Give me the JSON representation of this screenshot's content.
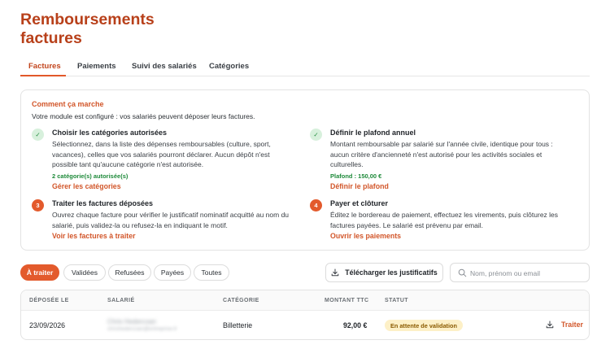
{
  "page": {
    "title_line1": "Remboursements",
    "title_line2": "factures"
  },
  "tabs": [
    {
      "label": "Factures",
      "active": true
    },
    {
      "label": "Paiements",
      "active": false
    },
    {
      "label": "Suivi des salariés",
      "active": false
    },
    {
      "label": "Catégories",
      "active": false
    }
  ],
  "how": {
    "title": "Comment ça marche",
    "subtitle": "Votre module est configuré : vos salariés peuvent déposer leurs factures.",
    "steps": [
      {
        "state": "done",
        "badge": "✓",
        "title": "Choisir les catégories autorisées",
        "description": "Sélectionnez, dans la liste des dépenses remboursables (culture, sport, vacances), celles que vos salariés pourront déclarer. Aucun dépôt n'est possible tant qu'aucune catégorie n'est autorisée.",
        "status": "2 catégorie(s) autorisée(s)",
        "link": "Gérer les catégories"
      },
      {
        "state": "done",
        "badge": "✓",
        "title": "Définir le plafond annuel",
        "description": "Montant remboursable par salarié sur l'année civile, identique pour tous : aucun critère d'ancienneté n'est autorisé pour les activités sociales et culturelles.",
        "status": "Plafond : 150,00 €",
        "link": "Définir le plafond"
      },
      {
        "state": "todo",
        "badge": "3",
        "title": "Traiter les factures déposées",
        "description": "Ouvrez chaque facture pour vérifier le justificatif nominatif acquitté au nom du salarié, puis validez-la ou refusez-la en indiquant le motif.",
        "status": "",
        "link": "Voir les factures à traiter"
      },
      {
        "state": "todo",
        "badge": "4",
        "title": "Payer et clôturer",
        "description": "Éditez le bordereau de paiement, effectuez les virements, puis clôturez les factures payées. Le salarié est prévenu par email.",
        "status": "",
        "link": "Ouvrir les paiements"
      }
    ]
  },
  "filters": [
    {
      "label": "À traiter",
      "active": true
    },
    {
      "label": "Validées",
      "active": false
    },
    {
      "label": "Refusées",
      "active": false
    },
    {
      "label": "Payées",
      "active": false
    },
    {
      "label": "Toutes",
      "active": false
    }
  ],
  "toolbar": {
    "download_label": "Télécharger les justificatifs",
    "search_placeholder": "Nom, prénom ou email",
    "search_value": ""
  },
  "table": {
    "headers": [
      "DÉPOSÉE LE",
      "SALARIÉ",
      "CATÉGORIE",
      "MONTANT TTC",
      "STATUT"
    ],
    "rows": [
      {
        "date": "23/09/2026",
        "employee_name": "Chris Hedercoan",
        "employee_email": "chrishedercoan@entreprise.fr",
        "category": "Billetterie",
        "amount": "92,00 €",
        "status": "En attente de validation",
        "action": "Traiter"
      }
    ]
  },
  "colors": {
    "brand": "#b8401a",
    "accent": "#e35a2c",
    "success": "#1e8a3a",
    "pending_bg": "#fdf0c7"
  }
}
